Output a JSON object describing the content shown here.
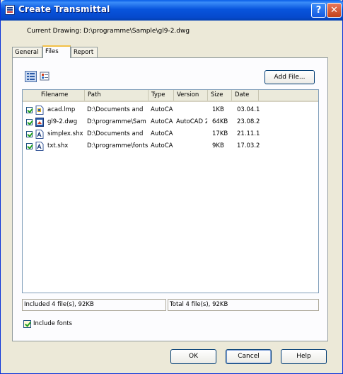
{
  "window": {
    "title": "Create Transmittal",
    "help_button": "?",
    "close_button": "✕"
  },
  "current_drawing": "Current Drawing: D:\\programme\\Sample\\gl9-2.dwg",
  "tabs": [
    {
      "label": "General",
      "active": false
    },
    {
      "label": "Files",
      "active": true
    },
    {
      "label": "Report",
      "active": false
    }
  ],
  "toolbar": {
    "list_view_icon": "list-view-icon",
    "tree_view_icon": "tree-view-icon",
    "add_file_label": "Add File..."
  },
  "file_list": {
    "columns": [
      "Filename",
      "Path",
      "Type",
      "Version",
      "Size",
      "Date"
    ],
    "rows": [
      {
        "checked": true,
        "icon": "plot-style-file-icon",
        "filename": "acad.lmp",
        "path": "D:\\Documents and",
        "type": "AutoCA",
        "version": "",
        "size": "1KB",
        "date": "03.04.1"
      },
      {
        "checked": true,
        "icon": "drawing-file-icon",
        "filename": "gl9-2.dwg",
        "path": "D:\\programme\\Sam",
        "type": "AutoCA",
        "version": "AutoCAD 2",
        "size": "64KB",
        "date": "23.08.2"
      },
      {
        "checked": true,
        "icon": "font-file-icon",
        "filename": "simplex.shx",
        "path": "D:\\Documents and",
        "type": "AutoCA",
        "version": "",
        "size": "17KB",
        "date": "21.11.1"
      },
      {
        "checked": true,
        "icon": "font-file-icon",
        "filename": "txt.shx",
        "path": "D:\\programme\\fonts",
        "type": "AutoCA",
        "version": "",
        "size": "9KB",
        "date": "17.03.2"
      }
    ]
  },
  "status": {
    "included": "Included 4 file(s), 92KB",
    "total": "Total 4 file(s), 92KB"
  },
  "include_fonts": {
    "label": "Include fonts",
    "checked": true
  },
  "buttons": {
    "ok": "OK",
    "cancel": "Cancel",
    "help": "Help"
  },
  "colors": {
    "titlebar": "#0855dd",
    "dialog_bg": "#ece9d8",
    "panel_bg": "#fcfcfe",
    "check_mark": "#21a121",
    "active_tab_accent": "#f3c047"
  }
}
